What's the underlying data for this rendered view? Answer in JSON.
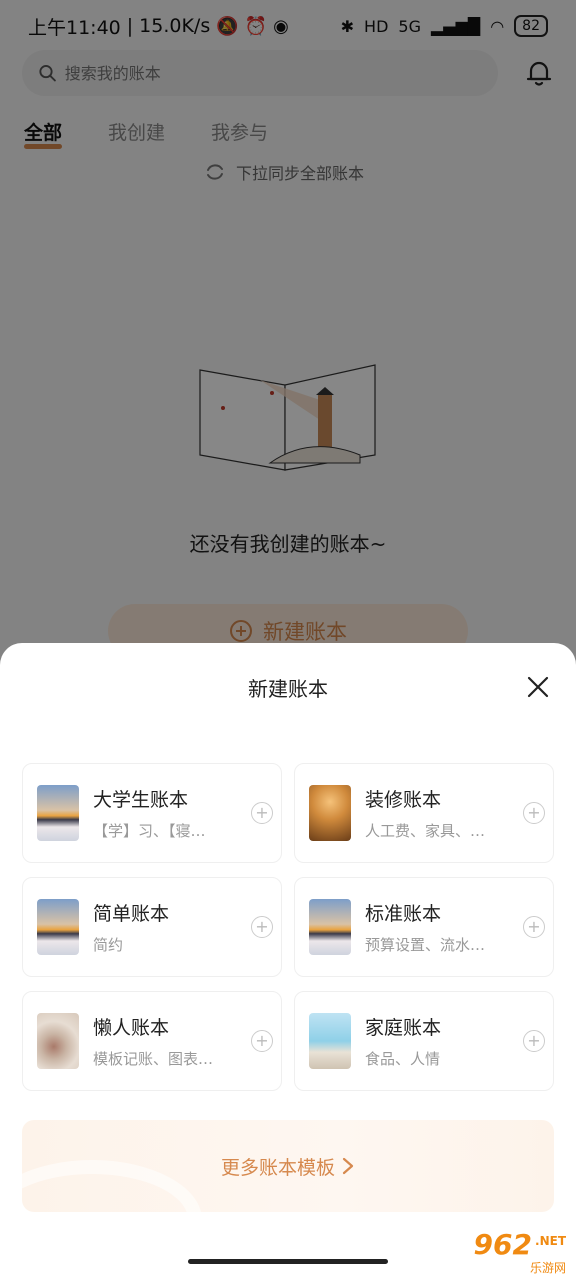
{
  "status_bar": {
    "time": "上午11:40",
    "speed": "15.0K/s",
    "hd": "HD",
    "network": "5G",
    "battery": "82"
  },
  "search": {
    "placeholder": "搜索我的账本"
  },
  "tabs": [
    {
      "label": "全部",
      "active": true
    },
    {
      "label": "我创建",
      "active": false
    },
    {
      "label": "我参与",
      "active": false
    }
  ],
  "sync_hint": "下拉同步全部账本",
  "empty_text": "还没有我创建的账本~",
  "create_button": "新建账本",
  "sheet": {
    "title": "新建账本",
    "templates": [
      {
        "name": "大学生账本",
        "desc": "【学】习、【寝…",
        "thumb": "sky-icon"
      },
      {
        "name": "装修账本",
        "desc": "人工费、家具、…",
        "thumb": "lamp-icon"
      },
      {
        "name": "简单账本",
        "desc": "简约",
        "thumb": "sky-icon"
      },
      {
        "name": "标准账本",
        "desc": "预算设置、流水…",
        "thumb": "sky-icon"
      },
      {
        "name": "懒人账本",
        "desc": "模板记账、图表…",
        "thumb": "tea-icon"
      },
      {
        "name": "家庭账本",
        "desc": "食品、人情",
        "thumb": "family-icon"
      }
    ],
    "more_label": "更多账本模板"
  },
  "watermark": {
    "number": "962",
    "net": ".NET",
    "sub": "乐游网"
  },
  "colors": {
    "accent": "#d6894e",
    "overlay": "rgba(0,0,0,0.47)"
  }
}
